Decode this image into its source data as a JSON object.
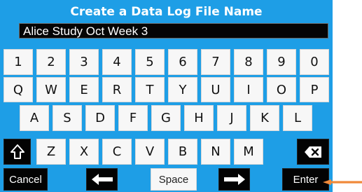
{
  "title": "Create a Data Log File Name",
  "file_name": {
    "value": "Alice Study Oct Week 3"
  },
  "keyboard": {
    "row_numbers": [
      "1",
      "2",
      "3",
      "4",
      "5",
      "6",
      "7",
      "8",
      "9",
      "0"
    ],
    "row_top": [
      "Q",
      "W",
      "E",
      "R",
      "T",
      "Y",
      "U",
      "I",
      "O",
      "P"
    ],
    "row_middle": [
      "A",
      "S",
      "D",
      "F",
      "G",
      "H",
      "J",
      "K",
      "L"
    ],
    "row_bottom": [
      "Z",
      "X",
      "C",
      "V",
      "B",
      "N",
      "M"
    ],
    "shift_icon": "shift-up-arrow-icon",
    "backspace_icon": "backspace-x-icon",
    "cancel_label": "Cancel",
    "left_arrow_icon": "left-arrow-icon",
    "space_label": "Space",
    "right_arrow_icon": "right-arrow-icon",
    "enter_label": "Enter"
  },
  "colors": {
    "screen_background": "#1e9ee6",
    "key_background": "#f7f7f7",
    "dark_key_background": "#030303",
    "pointer_arrow": "#f08a3a"
  }
}
